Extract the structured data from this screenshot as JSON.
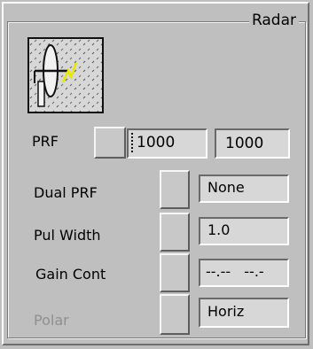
{
  "group": {
    "title": "Radar"
  },
  "icon": {
    "name": "radar-dish-icon"
  },
  "prf": {
    "label": "PRF",
    "input_value": "1000",
    "display_value": "1000"
  },
  "dual_prf": {
    "label": "Dual PRF",
    "value": "None"
  },
  "pul_width": {
    "label": "Pul Width",
    "value": "1.0"
  },
  "gain_cont": {
    "label": "Gain Cont",
    "value": "--.-- --.-"
  },
  "polar": {
    "label": "Polar",
    "value": "Horiz",
    "enabled": false
  },
  "colors": {
    "background": "#bfbfbf",
    "field": "#d7d7d7",
    "disabled_text": "#8f8f8f",
    "lightning": "#e8e800"
  }
}
